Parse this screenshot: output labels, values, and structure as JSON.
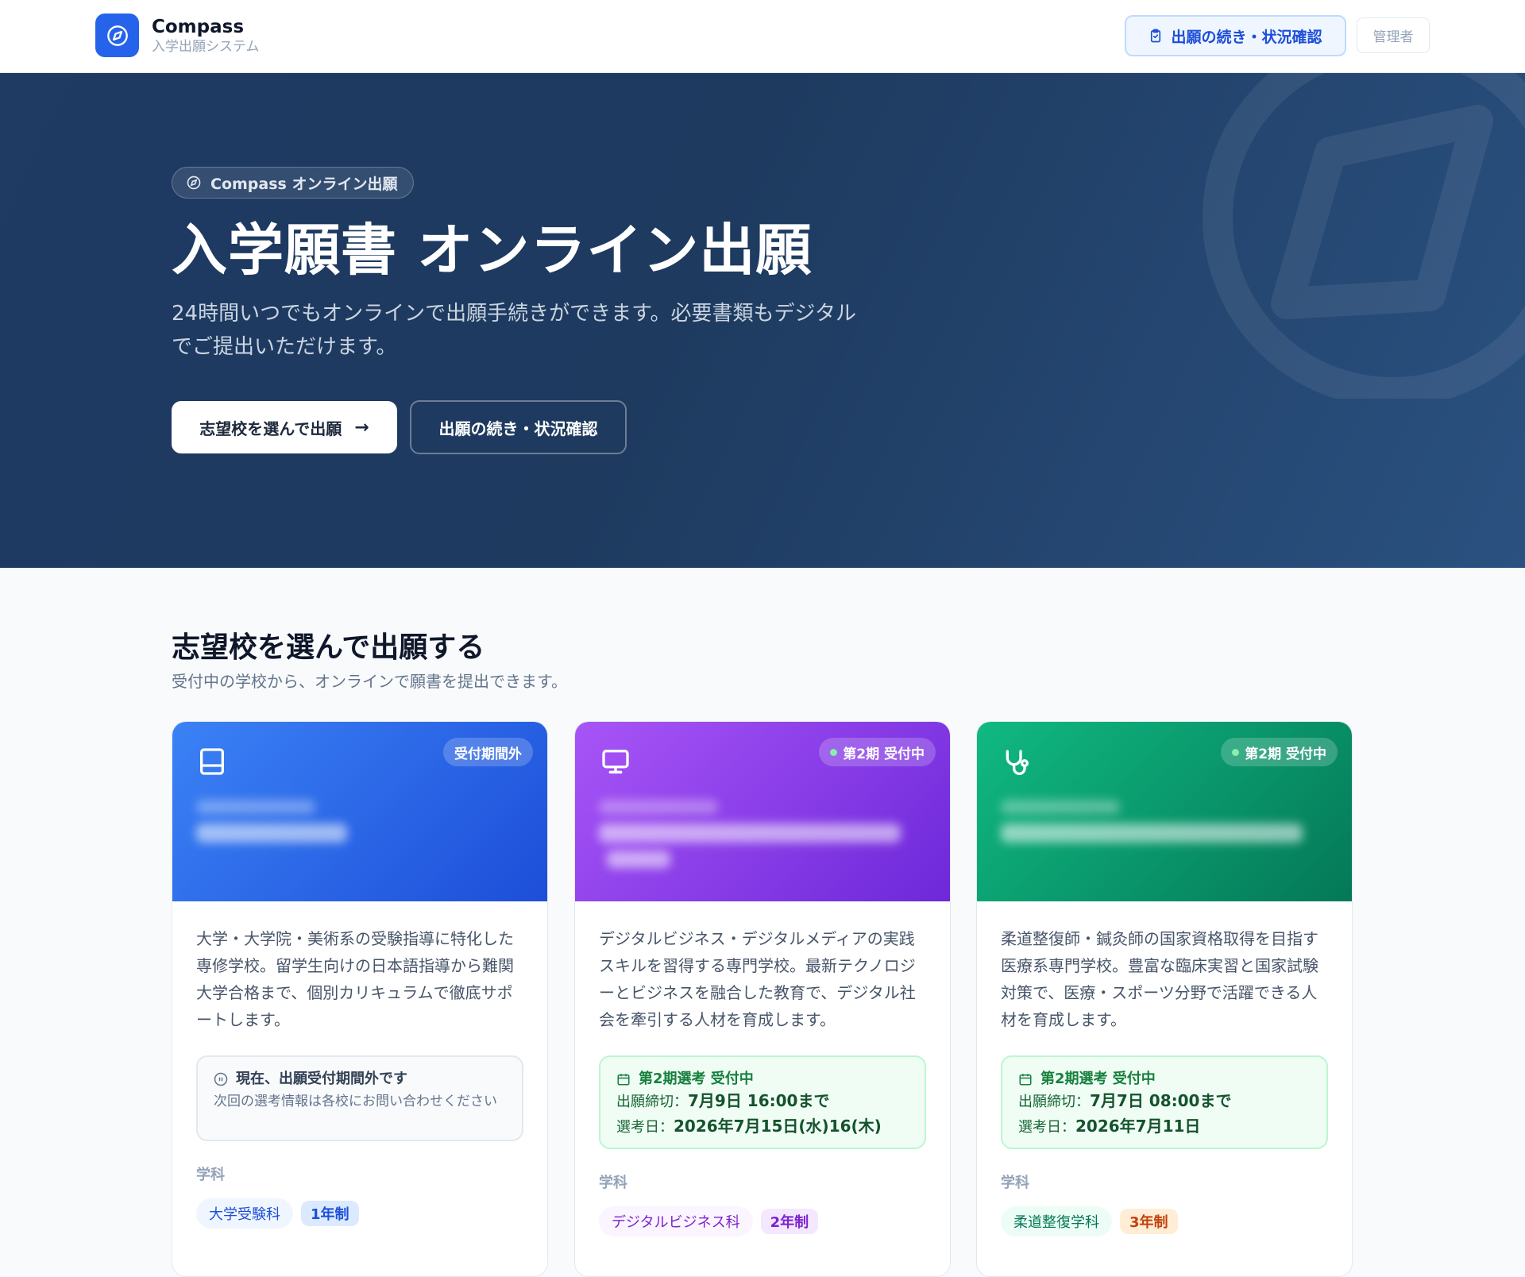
{
  "header": {
    "brand_name": "Compass",
    "brand_sub": "入学出願システム",
    "status_button": "出願の続き・状況確認",
    "admin_button": "管理者"
  },
  "hero": {
    "badge": "Compass オンライン出願",
    "title": "入学願書 オンライン出願",
    "description": "24時間いつでもオンラインで出願手続きができます。必要書類もデジタルでご提出いただけます。",
    "primary_button": "志望校を選んで出願",
    "secondary_button": "出願の続き・状況確認"
  },
  "section": {
    "title": "志望校を選んで出願する",
    "subtitle": "受付中の学校から、オンラインで願書を提出できます。"
  },
  "dept_label": "学科",
  "cards": [
    {
      "status_pill": "受付期間外",
      "icon": "book-icon",
      "description": "大学・大学院・美術系の受験指導に特化した専修学校。留学生向けの日本語指導から難関大学合格まで、個別カリキュラムで徹底サポートします。",
      "info_title": "現在、出願受付期間外です",
      "info_note": "次回の選考情報は各校にお問い合わせください",
      "department": "大学受験科",
      "years": "1年制",
      "colors": {
        "accent": "#2563eb"
      }
    },
    {
      "status_pill": "第2期 受付中",
      "icon": "monitor-icon",
      "description": "デジタルビジネス・デジタルメディアの実践スキルを習得する専門学校。最新テクノロジーとビジネスを融合した教育で、デジタル社会を牽引する人材を育成します。",
      "info_title": "第2期選考 受付中",
      "deadline_label": "出願締切：",
      "deadline": "7月9日 16:00まで",
      "exam_label": "選考日：",
      "exam_date": "2026年7月15日(水)16(木)",
      "department": "デジタルビジネス科",
      "years": "2年制",
      "colors": {
        "accent": "#7c3aed"
      }
    },
    {
      "status_pill": "第2期 受付中",
      "icon": "stethoscope-icon",
      "description": "柔道整復師・鍼灸師の国家資格取得を目指す医療系専門学校。豊富な臨床実習と国家試験対策で、医療・スポーツ分野で活躍できる人材を育成します。",
      "info_title": "第2期選考 受付中",
      "deadline_label": "出願締切：",
      "deadline": "7月7日 08:00まで",
      "exam_label": "選考日：",
      "exam_date": "2026年7月11日",
      "department": "柔道整復学科",
      "years": "3年制",
      "colors": {
        "accent": "#059669"
      }
    }
  ]
}
